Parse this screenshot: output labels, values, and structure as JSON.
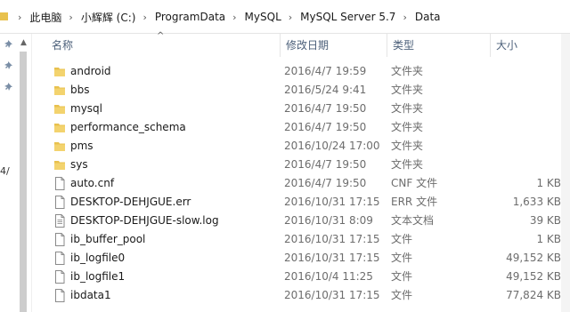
{
  "breadcrumb": [
    "此电脑",
    "小辉辉 (C:)",
    "ProgramData",
    "MySQL",
    "MySQL Server 5.7",
    "Data"
  ],
  "side_fragment": "4/",
  "columns": {
    "name": "名称",
    "date": "修改日期",
    "type": "类型",
    "size": "大小"
  },
  "colors": {
    "folder": "#e8c14e",
    "header_text": "#4c607a",
    "meta_text": "#6d6d6d"
  },
  "files": [
    {
      "name": "android",
      "date": "2016/4/7 19:59",
      "type": "文件夹",
      "size": "",
      "icon": "folder-icon"
    },
    {
      "name": "bbs",
      "date": "2016/5/24 9:41",
      "type": "文件夹",
      "size": "",
      "icon": "folder-icon"
    },
    {
      "name": "mysql",
      "date": "2016/4/7 19:50",
      "type": "文件夹",
      "size": "",
      "icon": "folder-icon"
    },
    {
      "name": "performance_schema",
      "date": "2016/4/7 19:50",
      "type": "文件夹",
      "size": "",
      "icon": "folder-icon"
    },
    {
      "name": "pms",
      "date": "2016/10/24 17:00",
      "type": "文件夹",
      "size": "",
      "icon": "folder-icon"
    },
    {
      "name": "sys",
      "date": "2016/4/7 19:50",
      "type": "文件夹",
      "size": "",
      "icon": "folder-icon"
    },
    {
      "name": "auto.cnf",
      "date": "2016/4/7 19:50",
      "type": "CNF 文件",
      "size": "1 KB",
      "icon": "file-icon"
    },
    {
      "name": "DESKTOP-DEHJGUE.err",
      "date": "2016/10/31 17:15",
      "type": "ERR 文件",
      "size": "1,633 KB",
      "icon": "file-icon"
    },
    {
      "name": "DESKTOP-DEHJGUE-slow.log",
      "date": "2016/10/31 8:09",
      "type": "文本文档",
      "size": "39 KB",
      "icon": "text-file-icon"
    },
    {
      "name": "ib_buffer_pool",
      "date": "2016/10/31 17:15",
      "type": "文件",
      "size": "1 KB",
      "icon": "file-icon"
    },
    {
      "name": "ib_logfile0",
      "date": "2016/10/31 17:15",
      "type": "文件",
      "size": "49,152 KB",
      "icon": "file-icon"
    },
    {
      "name": "ib_logfile1",
      "date": "2016/10/4 11:25",
      "type": "文件",
      "size": "49,152 KB",
      "icon": "file-icon"
    },
    {
      "name": "ibdata1",
      "date": "2016/10/31 17:15",
      "type": "文件",
      "size": "77,824 KB",
      "icon": "file-icon"
    }
  ]
}
